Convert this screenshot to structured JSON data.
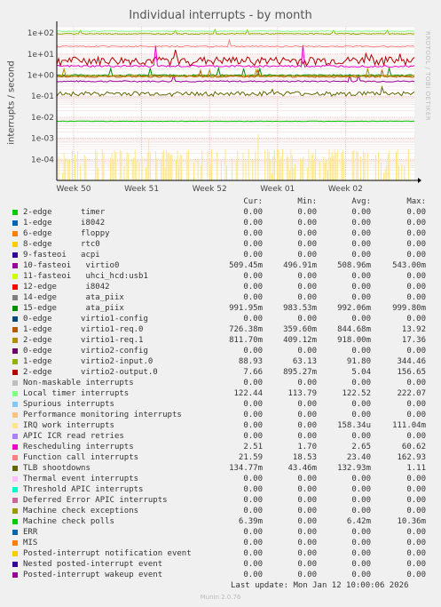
{
  "title": "Individual interrupts - by month",
  "side_label": "RRDTOOL / TOBI OETIKER",
  "footer": {
    "last_update": "Last update: Mon Jan 12 10:00:06 2026",
    "munin": "Munin 2.0.76"
  },
  "legend_header": {
    "cur": "Cur:",
    "min": "Min:",
    "avg": "Avg:",
    "max": "Max:"
  },
  "chart_data": {
    "type": "line",
    "ylabel": "interrupts / second",
    "yscale": "log",
    "ylim": [
      1e-05,
      200
    ],
    "ytick_labels": [
      "1e+02",
      "1e+01",
      "1e+00",
      "1e-01",
      "1e-02",
      "1e-03",
      "1e-04"
    ],
    "ytick_values": [
      100,
      10,
      1,
      0.1,
      0.01,
      0.001,
      0.0001
    ],
    "xtick_labels": [
      "Week 50",
      "Week 51",
      "Week 52",
      "Week 01",
      "Week 02"
    ],
    "grid": true,
    "series": [
      {
        "name": "2-edge      timer",
        "color": "#00cc00",
        "cur": "0.00",
        "min": "0.00",
        "avg": "0.00",
        "max": "0.00"
      },
      {
        "name": "1-edge      i8042",
        "color": "#0066b3",
        "cur": "0.00",
        "min": "0.00",
        "avg": "0.00",
        "max": "0.00"
      },
      {
        "name": "6-edge      floppy",
        "color": "#ff8000",
        "cur": "0.00",
        "min": "0.00",
        "avg": "0.00",
        "max": "0.00"
      },
      {
        "name": "8-edge      rtc0",
        "color": "#ffcc00",
        "cur": "0.00",
        "min": "0.00",
        "avg": "0.00",
        "max": "0.00"
      },
      {
        "name": "9-fasteoi   acpi",
        "color": "#330099",
        "cur": "0.00",
        "min": "0.00",
        "avg": "0.00",
        "max": "0.00"
      },
      {
        "name": "10-fasteoi   virtio0",
        "color": "#990099",
        "cur": "509.45m",
        "min": "496.91m",
        "avg": "508.96m",
        "max": "543.00m"
      },
      {
        "name": "11-fasteoi   uhci_hcd:usb1",
        "color": "#ccff00",
        "cur": "0.00",
        "min": "0.00",
        "avg": "0.00",
        "max": "0.00"
      },
      {
        "name": "12-edge      i8042",
        "color": "#ff0000",
        "cur": "0.00",
        "min": "0.00",
        "avg": "0.00",
        "max": "0.00"
      },
      {
        "name": "14-edge      ata_piix",
        "color": "#808080",
        "cur": "0.00",
        "min": "0.00",
        "avg": "0.00",
        "max": "0.00"
      },
      {
        "name": "15-edge      ata_piix",
        "color": "#008f00",
        "cur": "991.95m",
        "min": "983.53m",
        "avg": "992.06m",
        "max": "999.80m"
      },
      {
        "name": "0-edge      virtio1-config",
        "color": "#00487d",
        "cur": "0.00",
        "min": "0.00",
        "avg": "0.00",
        "max": "0.00"
      },
      {
        "name": "1-edge      virtio1-req.0",
        "color": "#b35a00",
        "cur": "726.38m",
        "min": "359.60m",
        "avg": "844.68m",
        "max": "13.92"
      },
      {
        "name": "2-edge      virtio1-req.1",
        "color": "#b38f00",
        "cur": "811.70m",
        "min": "409.12m",
        "avg": "918.00m",
        "max": "17.36"
      },
      {
        "name": "0-edge      virtio2-config",
        "color": "#6b006b",
        "cur": "0.00",
        "min": "0.00",
        "avg": "0.00",
        "max": "0.00"
      },
      {
        "name": "1-edge      virtio2-input.0",
        "color": "#8fb300",
        "cur": "88.93",
        "min": "63.13",
        "avg": "91.80",
        "max": "344.46"
      },
      {
        "name": "2-edge      virtio2-output.0",
        "color": "#b30000",
        "cur": "7.66",
        "min": "895.27m",
        "avg": "5.04",
        "max": "156.65"
      },
      {
        "name": "Non-maskable interrupts",
        "color": "#bebebe",
        "cur": "0.00",
        "min": "0.00",
        "avg": "0.00",
        "max": "0.00"
      },
      {
        "name": "Local timer interrupts",
        "color": "#80ff80",
        "cur": "122.44",
        "min": "113.79",
        "avg": "122.52",
        "max": "222.07"
      },
      {
        "name": "Spurious interrupts",
        "color": "#80c9ff",
        "cur": "0.00",
        "min": "0.00",
        "avg": "0.00",
        "max": "0.00"
      },
      {
        "name": "Performance monitoring interrupts",
        "color": "#ffc080",
        "cur": "0.00",
        "min": "0.00",
        "avg": "0.00",
        "max": "0.00"
      },
      {
        "name": "IRQ work interrupts",
        "color": "#ffe680",
        "cur": "0.00",
        "min": "0.00",
        "avg": "158.34u",
        "max": "111.04m"
      },
      {
        "name": "APIC ICR read retries",
        "color": "#aa80ff",
        "cur": "0.00",
        "min": "0.00",
        "avg": "0.00",
        "max": "0.00"
      },
      {
        "name": "Rescheduling interrupts",
        "color": "#ee00cc",
        "cur": "2.51",
        "min": "1.70",
        "avg": "2.65",
        "max": "60.62"
      },
      {
        "name": "Function call interrupts",
        "color": "#ff8080",
        "cur": "21.59",
        "min": "18.53",
        "avg": "23.40",
        "max": "162.93"
      },
      {
        "name": "TLB shootdowns",
        "color": "#666600",
        "cur": "134.77m",
        "min": "43.46m",
        "avg": "132.93m",
        "max": "1.11"
      },
      {
        "name": "Thermal event interrupts",
        "color": "#ffbfff",
        "cur": "0.00",
        "min": "0.00",
        "avg": "0.00",
        "max": "0.00"
      },
      {
        "name": "Threshold APIC interrupts",
        "color": "#00ffcc",
        "cur": "0.00",
        "min": "0.00",
        "avg": "0.00",
        "max": "0.00"
      },
      {
        "name": "Deferred Error APIC interrupts",
        "color": "#cc6699",
        "cur": "0.00",
        "min": "0.00",
        "avg": "0.00",
        "max": "0.00"
      },
      {
        "name": "Machine check exceptions",
        "color": "#999900",
        "cur": "0.00",
        "min": "0.00",
        "avg": "0.00",
        "max": "0.00"
      },
      {
        "name": "Machine check polls",
        "color": "#00cc00",
        "cur": "6.39m",
        "min": "0.00",
        "avg": "6.42m",
        "max": "10.36m"
      },
      {
        "name": "ERR",
        "color": "#0066b3",
        "cur": "0.00",
        "min": "0.00",
        "avg": "0.00",
        "max": "0.00"
      },
      {
        "name": "MIS",
        "color": "#ff8000",
        "cur": "0.00",
        "min": "0.00",
        "avg": "0.00",
        "max": "0.00"
      },
      {
        "name": "Posted-interrupt notification event",
        "color": "#ffcc00",
        "cur": "0.00",
        "min": "0.00",
        "avg": "0.00",
        "max": "0.00"
      },
      {
        "name": "Nested posted-interrupt event",
        "color": "#330099",
        "cur": "0.00",
        "min": "0.00",
        "avg": "0.00",
        "max": "0.00"
      },
      {
        "name": "Posted-interrupt wakeup event",
        "color": "#990099",
        "cur": "0.00",
        "min": "0.00",
        "avg": "0.00",
        "max": "0.00"
      }
    ]
  }
}
